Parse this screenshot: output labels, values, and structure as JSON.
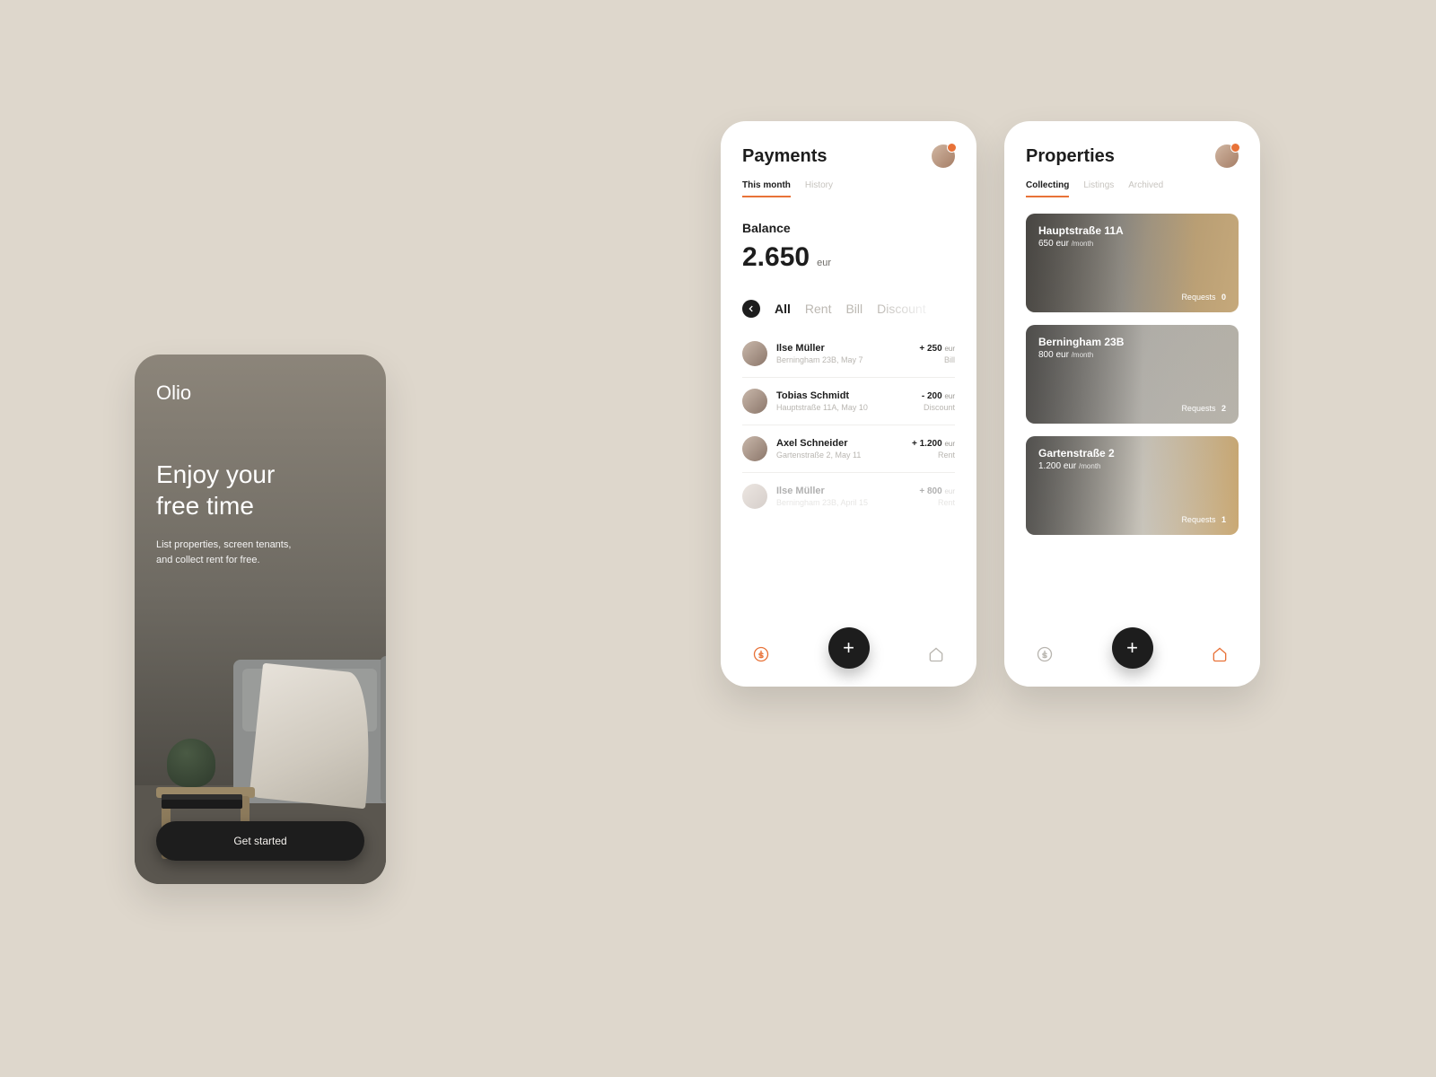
{
  "accent": "#e87238",
  "onboarding": {
    "brand": "Olio",
    "headline_l1": "Enjoy your",
    "headline_l2": "free time",
    "sub_l1": "List properties, screen tenants,",
    "sub_l2": "and collect rent for free.",
    "cta": "Get started"
  },
  "payments": {
    "title": "Payments",
    "tabs": {
      "this_month": "This month",
      "history": "History",
      "active": "this_month"
    },
    "balance_label": "Balance",
    "balance_value": "2.650",
    "balance_currency": "eur",
    "filters": {
      "items": [
        "All",
        "Rent",
        "Bill",
        "Discount"
      ],
      "active": "All",
      "back_icon": "chevron-left-icon"
    },
    "tx": [
      {
        "name": "Ilse Müller",
        "meta": "Berningham 23B, May 7",
        "amount": "+ 250",
        "unit": "eur",
        "kind": "Bill"
      },
      {
        "name": "Tobias Schmidt",
        "meta": "Hauptstraße 11A, May 10",
        "amount": "- 200",
        "unit": "eur",
        "kind": "Discount"
      },
      {
        "name": "Axel Schneider",
        "meta": "Gartenstraße 2, May 11",
        "amount": "+ 1.200",
        "unit": "eur",
        "kind": "Rent"
      },
      {
        "name": "Ilse Müller",
        "meta": "Berningham 23B, April 15",
        "amount": "+ 800",
        "unit": "eur",
        "kind": "Rent"
      }
    ],
    "nav": {
      "payments_icon": "dollar-icon",
      "home_icon": "home-icon",
      "fab_icon": "plus-icon"
    }
  },
  "properties": {
    "title": "Properties",
    "tabs": {
      "collecting": "Collecting",
      "listings": "Listings",
      "archived": "Archived",
      "active": "collecting"
    },
    "cards": [
      {
        "addr": "Hauptstraße 11A",
        "price": "650",
        "unit": "eur",
        "per": "/month",
        "req_label": "Requests",
        "req_n": "0"
      },
      {
        "addr": "Berningham 23B",
        "price": "800",
        "unit": "eur",
        "per": "/month",
        "req_label": "Requests",
        "req_n": "2"
      },
      {
        "addr": "Gartenstraße 2",
        "price": "1.200",
        "unit": "eur",
        "per": "/month",
        "req_label": "Requests",
        "req_n": "1"
      }
    ],
    "nav": {
      "payments_icon": "dollar-icon",
      "home_icon": "home-icon",
      "fab_icon": "plus-icon"
    }
  }
}
